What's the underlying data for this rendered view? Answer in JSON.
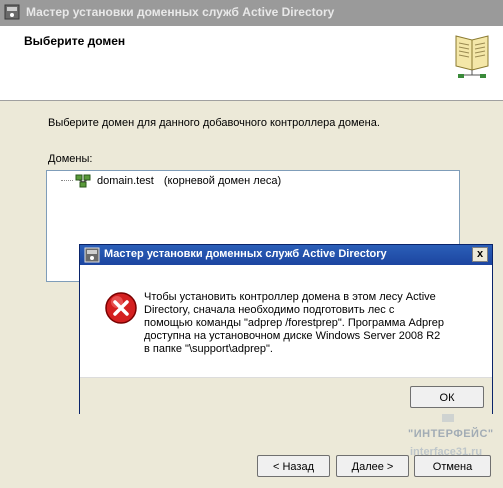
{
  "wizard": {
    "title": "Мастер установки доменных служб Active Directory",
    "heading": "Выберите домен",
    "prompt": "Выберите домен для данного добавочного контроллера домена.",
    "domains_label": "Домены:",
    "tree": [
      {
        "name": "domain.test",
        "note": "(корневой домен леса)"
      }
    ],
    "buttons": {
      "back": "< Назад",
      "next": "Далее >",
      "cancel": "Отмена"
    }
  },
  "dialog": {
    "title": "Мастер установки доменных служб Active Directory",
    "message": "Чтобы установить контроллер домена в этом лесу Active Directory, сначала необходимо подготовить лес с помощью команды \"adprep /forestprep\". Программа Adprep доступна на установочном диске Windows Server 2008 R2 в папке \"\\support\\adprep\".",
    "ok_label": "ОК",
    "close_label": "x",
    "icon": "error-icon"
  },
  "watermark": {
    "line1": "\"ИНТЕРФЕЙС\"",
    "line2": "interface31.ru"
  },
  "colors": {
    "dialog_title_bar": "#1c45a0",
    "wizard_title_bar_inactive": "#9a9a9a",
    "error_red": "#d42020"
  }
}
